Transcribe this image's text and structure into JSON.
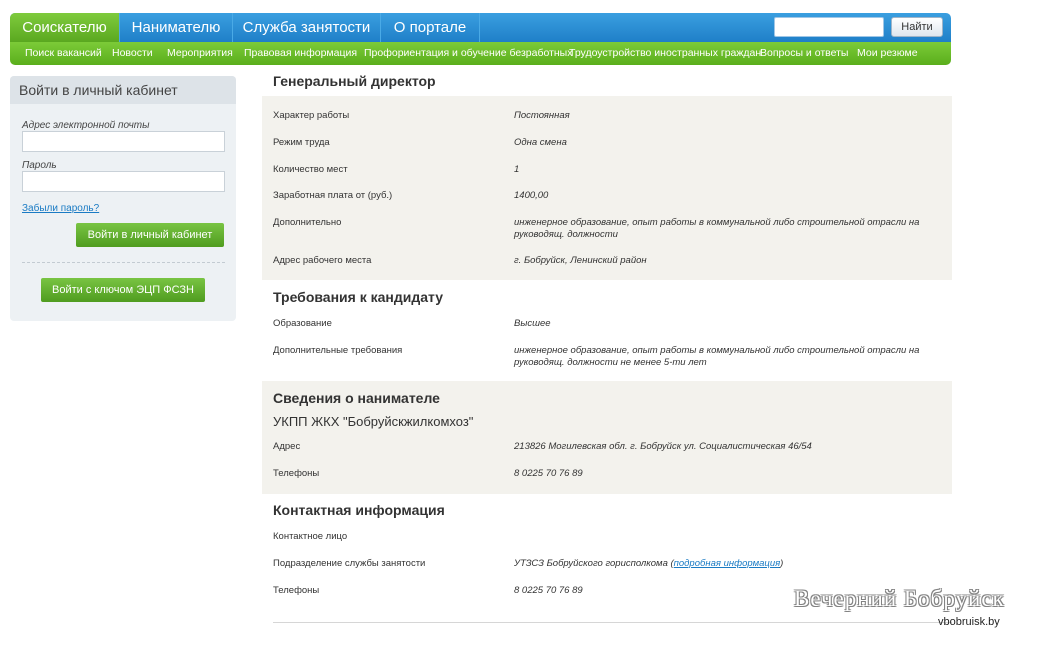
{
  "topnav": {
    "tabs": [
      "Соискателю",
      "Нанимателю",
      "Служба занятости",
      "О портале"
    ],
    "search_button": "Найти",
    "search_value": ""
  },
  "subnav": [
    "Поиск вакансий",
    "Новости",
    "Мероприятия",
    "Правовая информация",
    "Профориентация и обучение безработных",
    "Трудоустройство иностранных граждан",
    "Вопросы и ответы",
    "Мои резюме"
  ],
  "login": {
    "title": "Войти в личный кабинет",
    "email_label": "Адрес электронной почты",
    "password_label": "Пароль",
    "forgot": "Забыли пароль?",
    "login_button": "Войти в личный кабинет",
    "ecp_button": "Войти с ключом ЭЦП ФСЗН"
  },
  "vacancy": {
    "title": "Генеральный директор",
    "rows": [
      {
        "label": "Характер работы",
        "value": "Постоянная"
      },
      {
        "label": "Режим труда",
        "value": "Одна смена"
      },
      {
        "label": "Количество мест",
        "value": "1"
      },
      {
        "label": "Заработная плата от (руб.)",
        "value": "1400,00"
      },
      {
        "label": "Дополнительно",
        "value": "инженерное образование, опыт работы в коммунальной либо строительной отрасли на руководящ. должности"
      },
      {
        "label": "Адрес рабочего места",
        "value": "г. Бобруйск, Ленинский район"
      }
    ]
  },
  "requirements": {
    "title": "Требования к кандидату",
    "rows": [
      {
        "label": "Образование",
        "value": "Высшее"
      },
      {
        "label": "Дополнительные требования",
        "value": "инженерное образование, опыт работы в коммунальной либо строительной отрасли на руководящ. должности не менее 5-ти лет"
      }
    ]
  },
  "employer": {
    "title": "Сведения о нанимателе",
    "name": "УКПП ЖКХ \"Бобруйскжилкомхоз\"",
    "rows": [
      {
        "label": "Адрес",
        "value": "213826 Могилевская обл. г. Бобруйск ул. Социалистическая 46/54"
      },
      {
        "label": "Телефоны",
        "value": "8 0225 70 76 89"
      }
    ]
  },
  "contact": {
    "title": "Контактная информация",
    "person_label": "Контактное лицо",
    "person_value": "",
    "division_label": "Подразделение службы занятости",
    "division_value": "УТЗСЗ Бобруйского горисполкома",
    "division_link": "подробная информация",
    "phones_label": "Телефоны",
    "phones_value": "8 0225 70 76 89"
  },
  "watermark": {
    "logo": "Вечерний Бобруйск",
    "url": "vbobruisk.by"
  }
}
